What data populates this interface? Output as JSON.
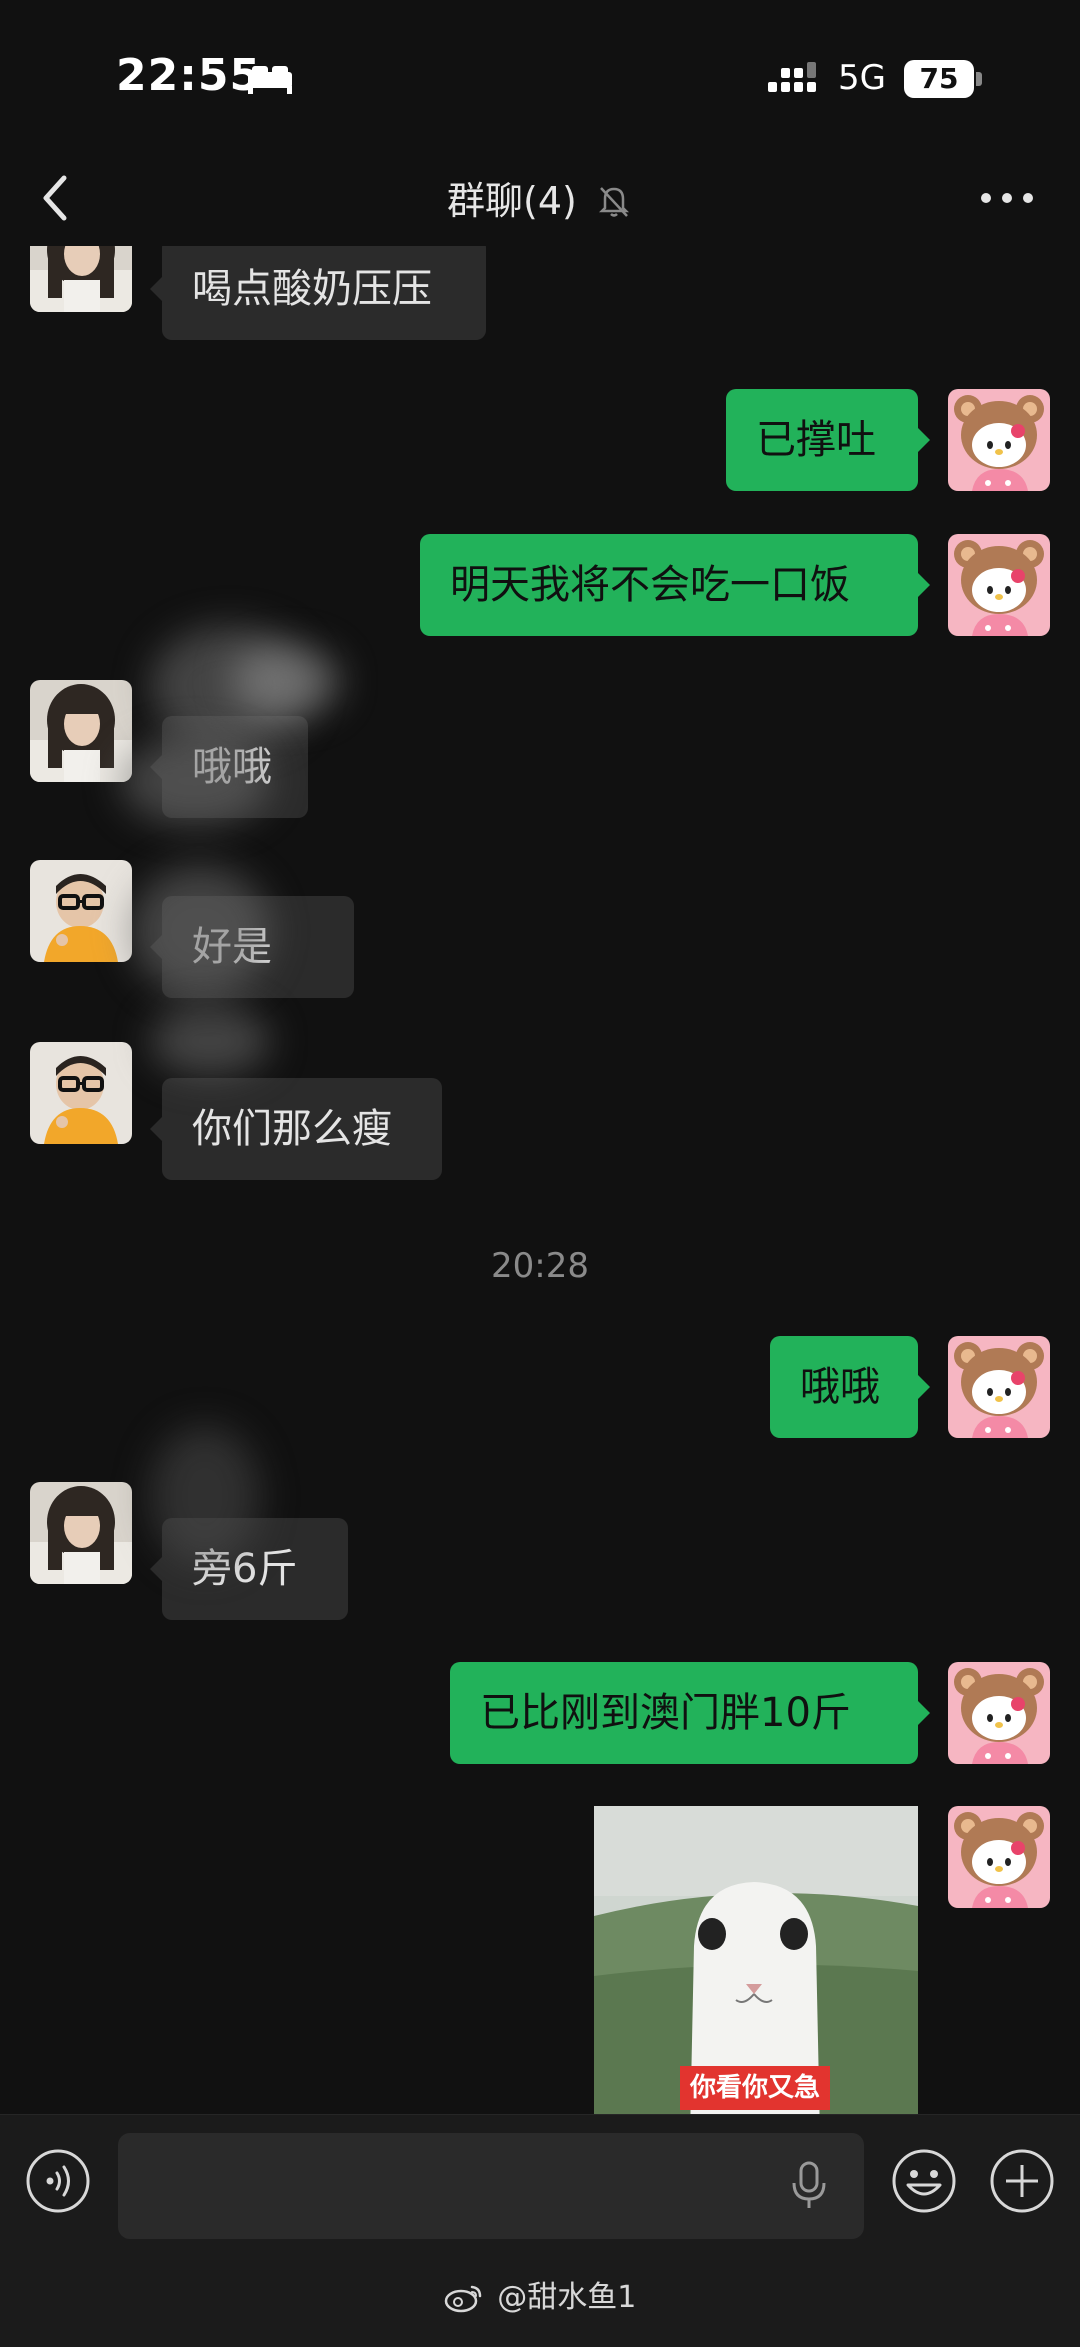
{
  "status_bar": {
    "time": "22:55",
    "network": "5G",
    "battery": "75",
    "icons": [
      "sleep-icon",
      "signal-icon",
      "battery-icon"
    ]
  },
  "nav": {
    "title": "群聊(4)",
    "icons": [
      "back-chevron-icon",
      "bell-muted-icon",
      "more-dots-icon"
    ]
  },
  "messages": [
    {
      "side": "in",
      "sender": "girl",
      "text": "喝点酸奶压压"
    },
    {
      "side": "out",
      "sender": "me",
      "text": "已撑吐"
    },
    {
      "side": "out",
      "sender": "me",
      "text": "明天我将不会吃一口饭"
    },
    {
      "side": "in",
      "sender": "girl",
      "text": "哦哦"
    },
    {
      "side": "in",
      "sender": "boy",
      "text": "好是"
    },
    {
      "side": "in",
      "sender": "boy",
      "text": "你们那么瘦"
    },
    {
      "type": "time",
      "text": "20:28"
    },
    {
      "side": "out",
      "sender": "me",
      "text": "哦哦"
    },
    {
      "side": "in",
      "sender": "girl",
      "text": "旁6斤"
    },
    {
      "side": "out",
      "sender": "me",
      "text": "已比刚到澳门胖10斤"
    },
    {
      "side": "out",
      "sender": "me",
      "type": "sticker",
      "caption": "你看你又急"
    }
  ],
  "input_bar": {
    "placeholder": "",
    "icons": [
      "voice-icon",
      "mic-icon",
      "emoji-icon",
      "plus-icon"
    ]
  },
  "watermark": {
    "text": "@甜水鱼1",
    "icon": "weibo-icon"
  },
  "colors": {
    "background": "#111111",
    "incoming_bubble": "#2b2b2b",
    "outgoing_bubble": "#22b25a",
    "sticker_caption": "#e2342f"
  }
}
